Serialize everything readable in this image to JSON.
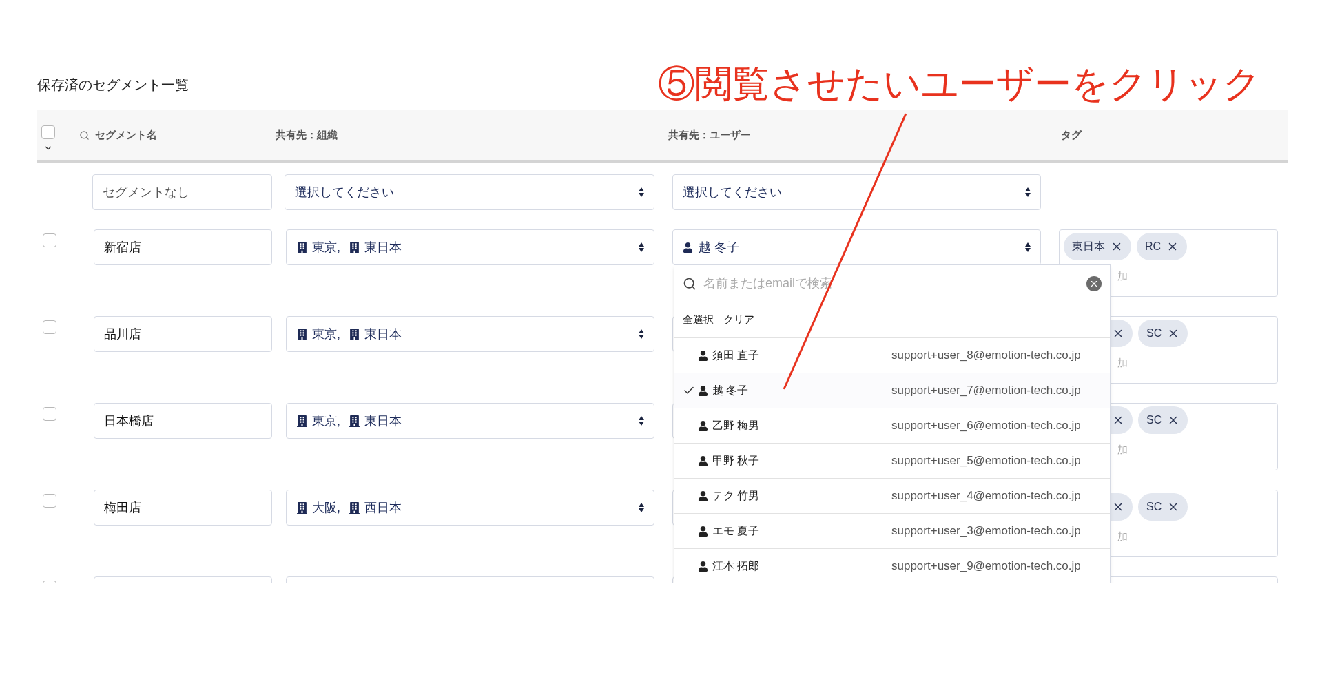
{
  "title": "保存済のセグメント一覧",
  "annotation": {
    "text": "⑤閲覧させたいユーザーをクリック"
  },
  "table": {
    "select_all": {
      "checked": false
    },
    "columns": [
      {
        "label": "セグメント名",
        "kind": "search"
      },
      {
        "label": "共有先：組織",
        "kind": "plain"
      },
      {
        "label": "共有先：ユーザー",
        "kind": "plain"
      },
      {
        "label": "タグ",
        "kind": "plain"
      }
    ],
    "filters": {
      "segment_placeholder": "セグメントなし",
      "org_placeholder": "選択してください",
      "user_placeholder": "選択してください"
    },
    "rows": [
      {
        "checked": false,
        "name": "新宿店",
        "orgs": [
          "東京,",
          "東日本"
        ],
        "user": "越 冬子",
        "tags": [
          {
            "kind": "label",
            "label": "東日本"
          },
          {
            "kind": "label",
            "label": "RC"
          }
        ],
        "tag_placeholder": "加"
      },
      {
        "checked": false,
        "name": "品川店",
        "orgs": [
          "東京,",
          "東日本"
        ],
        "tags": [
          {
            "kind": "covered"
          },
          {
            "kind": "label",
            "label": "SC"
          }
        ],
        "tag_placeholder": "加"
      },
      {
        "checked": false,
        "name": "日本橋店",
        "orgs": [
          "東京,",
          "東日本"
        ],
        "tags": [
          {
            "kind": "covered"
          },
          {
            "kind": "label",
            "label": "SC"
          }
        ],
        "tag_placeholder": "加"
      },
      {
        "checked": false,
        "name": "梅田店",
        "orgs": [
          "大阪,",
          "西日本"
        ],
        "tags": [
          {
            "kind": "covered"
          },
          {
            "kind": "label",
            "label": "SC"
          }
        ],
        "tag_placeholder": "加"
      },
      {
        "checked": false
      }
    ]
  },
  "dropdown": {
    "search_placeholder": "名前またはemailで検索",
    "actions": [
      "全選択",
      "クリア"
    ],
    "options": [
      {
        "name": "須田 直子",
        "email": "support+user_8@emotion-tech.co.jp",
        "selected": false
      },
      {
        "name": "越 冬子",
        "email": "support+user_7@emotion-tech.co.jp",
        "selected": true
      },
      {
        "name": "乙野 梅男",
        "email": "support+user_6@emotion-tech.co.jp",
        "selected": false
      },
      {
        "name": "甲野 秋子",
        "email": "support+user_5@emotion-tech.co.jp",
        "selected": false
      },
      {
        "name": "テク 竹男",
        "email": "support+user_4@emotion-tech.co.jp",
        "selected": false
      },
      {
        "name": "エモ 夏子",
        "email": "support+user_3@emotion-tech.co.jp",
        "selected": false
      },
      {
        "name": "江本 拓郎",
        "email": "support+user_9@emotion-tech.co.jp",
        "selected": false
      }
    ]
  }
}
